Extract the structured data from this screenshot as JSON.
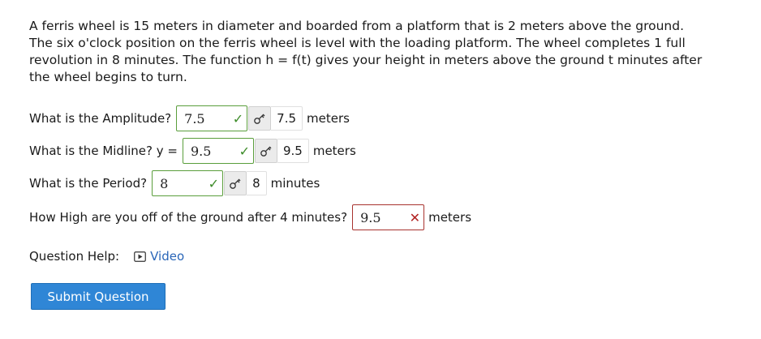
{
  "problem": {
    "text_lines": [
      "A ferris wheel is 15 meters in diameter and boarded from a platform that is 2 meters above the ground.",
      "The six o'clock position on the ferris wheel is level with the loading platform. The wheel completes 1 full",
      "revolution in 8 minutes. The function h = f(t) gives your height in meters above the ground t minutes after",
      "the wheel begins to turn."
    ]
  },
  "questions": {
    "amplitude": {
      "prompt": "What is the Amplitude?",
      "entered": "7.5",
      "status": "correct",
      "correct_answer": "7.5",
      "unit": "meters"
    },
    "midline": {
      "prompt": "What is the Midline? y =",
      "entered": "9.5",
      "status": "correct",
      "correct_answer": "9.5",
      "unit": "meters"
    },
    "period": {
      "prompt": "What is the Period?",
      "entered": "8",
      "status": "correct",
      "correct_answer": "8",
      "unit": "minutes"
    },
    "height": {
      "prompt": "How High are you off of the ground after 4 minutes?",
      "entered": "9.5",
      "status": "incorrect",
      "unit": "meters"
    }
  },
  "icons": {
    "correct": "✓",
    "incorrect": "✕",
    "key": "key-icon",
    "video": "video-icon"
  },
  "help": {
    "label": "Question Help:",
    "video_label": "Video"
  },
  "submit_label": "Submit Question",
  "colors": {
    "correct": "#3d8c29",
    "incorrect": "#b22222",
    "link": "#2a66b8",
    "button": "#2f86d6"
  }
}
